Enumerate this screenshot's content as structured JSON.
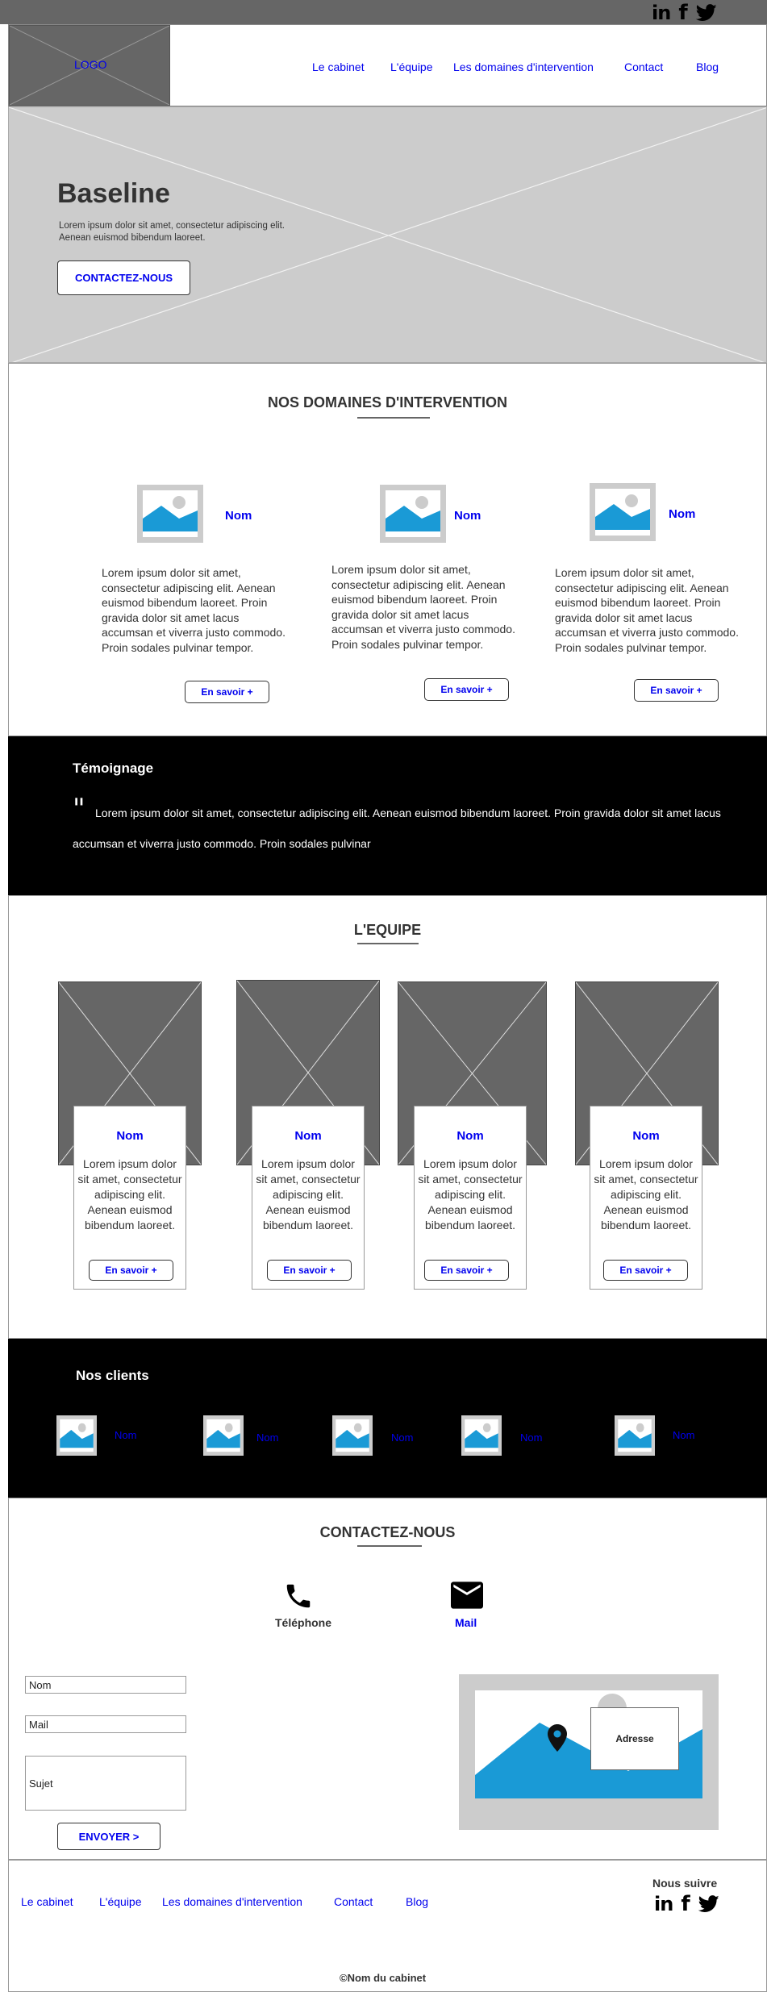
{
  "social": {
    "linkedin": "in",
    "facebook": "f",
    "twitter": "twitter"
  },
  "header": {
    "logo": "LOGO",
    "nav": [
      {
        "label": "Le cabinet"
      },
      {
        "label": "L'équipe"
      },
      {
        "label": "Les domaines d'intervention"
      },
      {
        "label": "Contact"
      },
      {
        "label": "Blog"
      }
    ]
  },
  "hero": {
    "title": "Baseline",
    "text": "Lorem ipsum dolor sit amet, consectetur adipiscing elit. Aenean euismod bibendum laoreet.",
    "cta": "CONTACTEZ-NOUS"
  },
  "domaines": {
    "title": "NOS DOMAINES D'INTERVENTION",
    "items": [
      {
        "name": "Nom",
        "text": "Lorem ipsum dolor sit amet, consectetur adipiscing elit. Aenean euismod bibendum laoreet. Proin gravida dolor sit amet lacus accumsan et viverra justo commodo. Proin sodales pulvinar tempor.",
        "button": "En savoir +"
      },
      {
        "name": "Nom",
        "text": "Lorem ipsum dolor sit amet, consectetur adipiscing elit. Aenean euismod bibendum laoreet. Proin gravida dolor sit amet lacus accumsan et viverra justo commodo. Proin sodales pulvinar tempor.",
        "button": "En savoir +"
      },
      {
        "name": "Nom",
        "text": "Lorem ipsum dolor sit amet, consectetur adipiscing elit. Aenean euismod bibendum laoreet. Proin gravida dolor sit amet lacus accumsan et viverra justo commodo. Proin sodales pulvinar tempor.",
        "button": "En savoir +"
      }
    ]
  },
  "temoignage": {
    "title": "Témoignage",
    "quote_mark": "\"",
    "text": "Lorem ipsum dolor sit amet, consectetur adipiscing elit. Aenean euismod bibendum laoreet. Proin gravida dolor sit amet lacus accumsan et viverra justo commodo. Proin sodales pulvinar"
  },
  "equipe": {
    "title": "L'EQUIPE",
    "members": [
      {
        "name": "Nom",
        "text": "Lorem ipsum dolor sit amet, consectetur adipiscing elit. Aenean euismod bibendum laoreet.",
        "button": "En savoir +"
      },
      {
        "name": "Nom",
        "text": "Lorem ipsum dolor sit amet, consectetur adipiscing elit. Aenean euismod bibendum laoreet.",
        "button": "En savoir +"
      },
      {
        "name": "Nom",
        "text": "Lorem ipsum dolor sit amet, consectetur adipiscing elit. Aenean euismod bibendum laoreet.",
        "button": "En savoir +"
      },
      {
        "name": "Nom",
        "text": "Lorem ipsum dolor sit amet, consectetur adipiscing elit. Aenean euismod bibendum laoreet.",
        "button": "En savoir +"
      }
    ]
  },
  "clients": {
    "title": "Nos clients",
    "items": [
      {
        "name": "Nom"
      },
      {
        "name": "Nom"
      },
      {
        "name": "Nom"
      },
      {
        "name": "Nom"
      },
      {
        "name": "Nom"
      }
    ]
  },
  "contact": {
    "title": "CONTACTEZ-NOUS",
    "phone_label": "Téléphone",
    "mail_label": "Mail",
    "form": {
      "nom": "Nom",
      "mail": "Mail",
      "sujet": "Sujet",
      "submit": "ENVOYER >"
    },
    "map_label": "Adresse"
  },
  "footer": {
    "nav": [
      {
        "label": "Le cabinet"
      },
      {
        "label": "L'équipe"
      },
      {
        "label": "Les domaines d'intervention"
      },
      {
        "label": "Contact"
      },
      {
        "label": "Blog"
      }
    ],
    "follow": "Nous suivre",
    "copyright": "©Nom du cabinet"
  },
  "colors": {
    "link": "#0000ee",
    "image_blue": "#1a9ad6",
    "placeholder_gray": "#666666",
    "light_gray": "#cccccc"
  }
}
